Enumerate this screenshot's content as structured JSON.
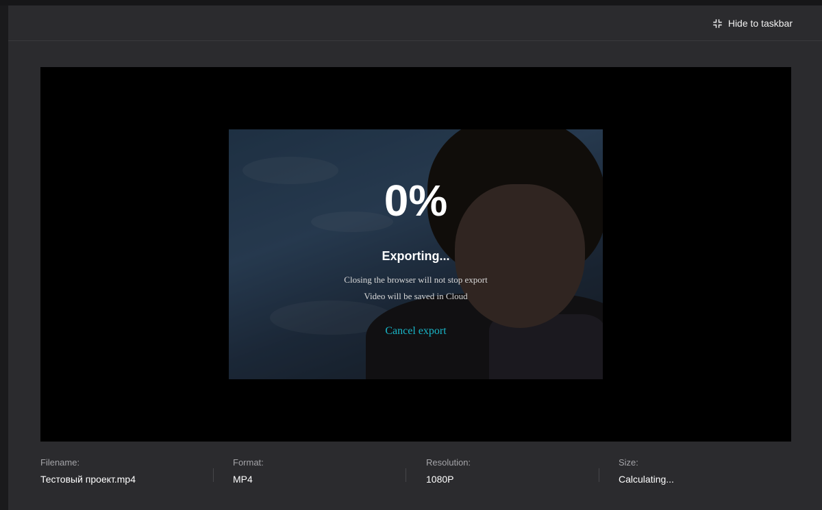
{
  "header": {
    "hide_label": "Hide to taskbar",
    "hide_icon": "minimize-arrows-icon"
  },
  "export": {
    "percent": "0%",
    "progress": 0,
    "status": "Exporting...",
    "note_line1": "Closing the browser will not stop export",
    "note_line2": "Video will be saved in Cloud",
    "cancel_label": "Cancel export"
  },
  "info": {
    "filename_label": "Filename:",
    "filename_value": "Тестовый проект.mp4",
    "format_label": "Format:",
    "format_value": "MP4",
    "resolution_label": "Resolution:",
    "resolution_value": "1080P",
    "size_label": "Size:",
    "size_value": "Calculating..."
  },
  "colors": {
    "accent": "#19b6c8",
    "modal_bg": "#2b2b2e",
    "preview_bg": "#000000"
  }
}
